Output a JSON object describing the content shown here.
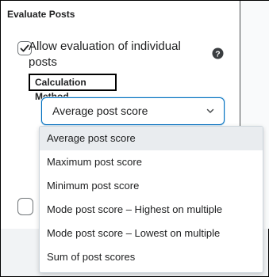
{
  "section": {
    "title": "Evaluate Posts"
  },
  "evaluation": {
    "allow_label": "Allow evaluation of individual posts",
    "allow_checked": true,
    "help_icon": "help-circle-icon"
  },
  "calculation": {
    "label": "Calculation Method",
    "selected": "Average post score",
    "chevron_icon": "chevron-down-icon",
    "options": [
      "Average post score",
      "Maximum post score",
      "Minimum post score",
      "Mode post score – Highest on multiple",
      "Mode post score – Lowest on multiple",
      "Sum of post scores"
    ],
    "highlighted_option": "Average post score"
  },
  "colors": {
    "focus_border": "#006fbf",
    "text": "#202122",
    "highlight_bg": "#e9ecef"
  }
}
